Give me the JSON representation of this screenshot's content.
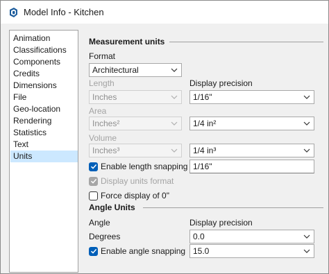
{
  "window": {
    "title": "Model Info - Kitchen",
    "app_icon": "sketchup-logo-icon"
  },
  "nav": {
    "items": [
      {
        "label": "Animation"
      },
      {
        "label": "Classifications"
      },
      {
        "label": "Components"
      },
      {
        "label": "Credits"
      },
      {
        "label": "Dimensions"
      },
      {
        "label": "File"
      },
      {
        "label": "Geo-location"
      },
      {
        "label": "Rendering"
      },
      {
        "label": "Statistics"
      },
      {
        "label": "Text"
      },
      {
        "label": "Units"
      }
    ],
    "selected": "Units"
  },
  "measurement": {
    "title": "Measurement units",
    "format_label": "Format",
    "format_value": "Architectural",
    "length_label": "Length",
    "length_value": "Inches",
    "display_precision_label": "Display precision",
    "length_precision": "1/16\"",
    "area_label": "Area",
    "area_value": "Inches²",
    "area_precision": "1/4 in²",
    "volume_label": "Volume",
    "volume_value": "Inches³",
    "volume_precision": "1/4 in³",
    "length_snapping_label": "Enable length snapping",
    "length_snapping_checked": true,
    "length_snapping_value": "1/16\"",
    "display_units_format_label": "Display units format",
    "display_units_format_checked": true,
    "force_zero_label": "Force display of 0\"",
    "force_zero_checked": false
  },
  "angle": {
    "title": "Angle Units",
    "angle_label": "Angle",
    "display_precision_label": "Display precision",
    "angle_value": "Degrees",
    "angle_precision": "0.0",
    "angle_snapping_label": "Enable angle snapping",
    "angle_snapping_checked": true,
    "angle_snapping_value": "15.0"
  },
  "colors": {
    "accent": "#005fb8",
    "selection": "#cce8ff"
  }
}
